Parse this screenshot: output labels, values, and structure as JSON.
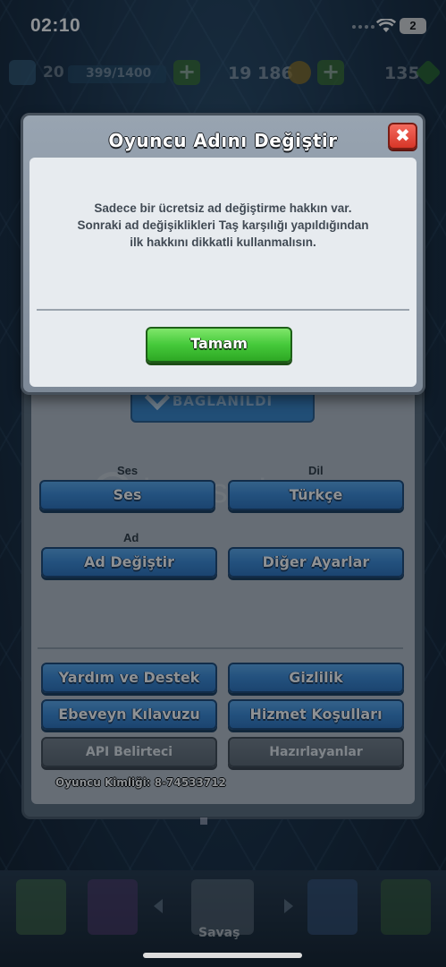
{
  "status_bar": {
    "time": "02:10",
    "battery": "2"
  },
  "resources": {
    "level": "20",
    "xp": "399/1400",
    "gold": "19 186",
    "gems": "135"
  },
  "settings": {
    "connected_label": "BAĞLANILDI",
    "watermark": "itemsatis",
    "sound_label": "Ses",
    "sound_button": "Ses",
    "language_label": "Dil",
    "language_button": "Türkçe",
    "name_label": "Ad",
    "change_name_button": "Ad Değiştir",
    "other_settings_button": "Diğer Ayarlar",
    "help_button": "Yardım ve Destek",
    "privacy_button": "Gizlilik",
    "parent_guide_button": "Ebeveyn Kılavuzu",
    "terms_button": "Hizmet Koşulları",
    "api_token_button": "API Belirteci",
    "credits_button": "Hazırlayanlar",
    "player_id": "Oyuncu Kimliği: 8-74533712"
  },
  "modal": {
    "title": "Oyuncu Adını Değiştir",
    "close_symbol": "✖",
    "message": "Sadece bir ücretsiz ad değiştirme hakkın var. Sonraki ad değişiklikleri Taş karşılığı yapıldığından ilk hakkını dikkatli kullanmalısın.",
    "ok_button": "Tamam"
  },
  "bottom_nav": {
    "active_label": "Savaş"
  },
  "colors": {
    "blue_button": "#3c8ad6",
    "green_button": "#45c93a",
    "close_red": "#d73628",
    "gray_button": "#5e6872"
  }
}
